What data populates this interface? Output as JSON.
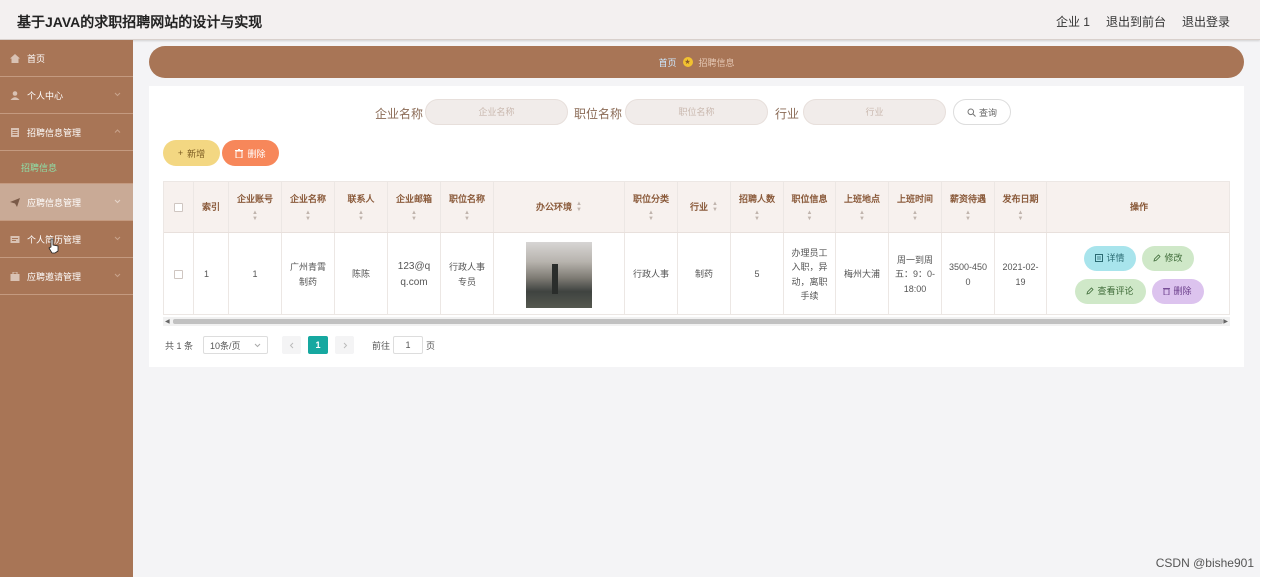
{
  "header": {
    "title": "基于JAVA的求职招聘网站的设计与实现",
    "user": "企业 1",
    "to_front": "退出到前台",
    "logout": "退出登录"
  },
  "sidebar": {
    "items": [
      {
        "label": "首页",
        "icon": "home-icon"
      },
      {
        "label": "个人中心",
        "icon": "user-icon"
      },
      {
        "label": "招聘信息管理",
        "icon": "doc-icon"
      },
      {
        "label": "应聘信息管理",
        "icon": "send-icon"
      },
      {
        "label": "个人简历管理",
        "icon": "resume-icon"
      },
      {
        "label": "应聘邀请管理",
        "icon": "invite-icon"
      }
    ],
    "submenu_label": "招聘信息"
  },
  "breadcrumb": {
    "home": "首页",
    "current": "招聘信息"
  },
  "search": {
    "company_label": "企业名称",
    "company_placeholder": "企业名称",
    "position_label": "职位名称",
    "position_placeholder": "职位名称",
    "industry_label": "行业",
    "industry_placeholder": "行业",
    "query_button": "查询"
  },
  "actions": {
    "add": "新增",
    "delete": "删除"
  },
  "table": {
    "headers": [
      "索引",
      "企业账号",
      "企业名称",
      "联系人",
      "企业邮箱",
      "职位名称",
      "办公环境",
      "职位分类",
      "行业",
      "招聘人数",
      "职位信息",
      "上班地点",
      "上班时间",
      "薪资待遇",
      "发布日期",
      "操作"
    ],
    "rows": [
      {
        "index": "1",
        "account": "1",
        "company": "广州青霄制药",
        "contact": "陈陈",
        "email": "123@qq.com",
        "position": "行政人事专员",
        "category": "行政人事",
        "industry": "制药",
        "count": "5",
        "info": "办理员工入职，异动，离职手续",
        "location": "梅州大浦",
        "hours": "周一到周五：9：0-18:00",
        "salary": "3500-4500",
        "date": "2021-02-19"
      }
    ],
    "op_labels": {
      "detail": "详情",
      "edit": "修改",
      "review": "查看评论",
      "delete": "删除"
    }
  },
  "pagination": {
    "total": "共 1 条",
    "page_size": "10条/页",
    "current_page": "1",
    "goto_label": "前往",
    "goto_value": "1",
    "page_suffix": "页"
  },
  "watermark": "CSDN @bishe901",
  "colors": {
    "brand": "#a87556",
    "active_submenu": "#8ee0a8",
    "page_active": "#16a8a0"
  }
}
